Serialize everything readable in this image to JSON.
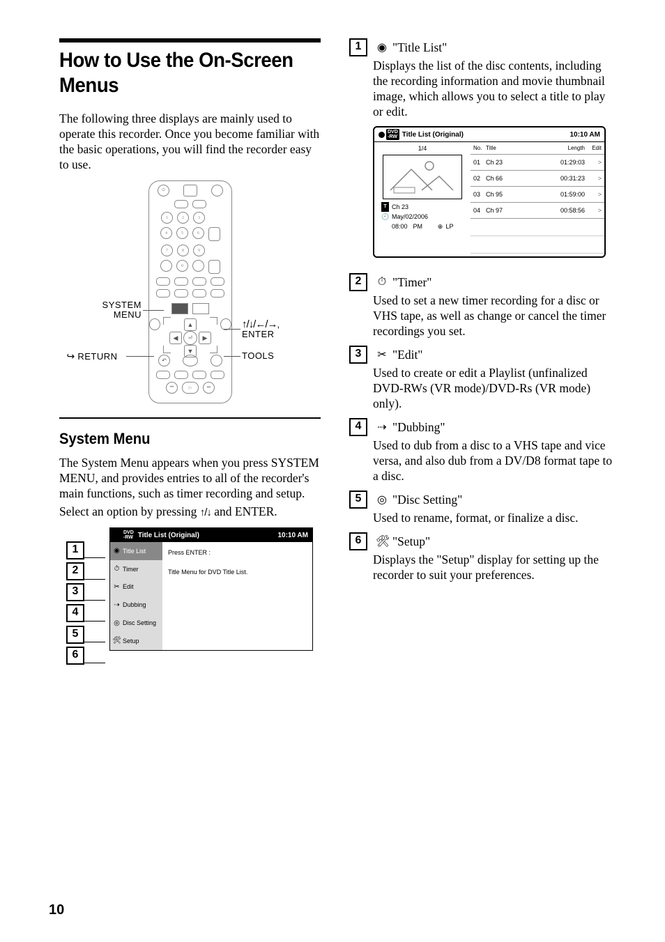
{
  "page_number": "10",
  "heading": "How to Use the On-Screen Menus",
  "intro": "The following three displays are mainly used to operate this recorder. Once you become familiar with the basic operations, you will find the recorder easy to use.",
  "remote_labels": {
    "system_menu": "SYSTEM MENU",
    "return": "RETURN",
    "arrows_enter_line1": "M/m/</,,",
    "arrows_enter_line2": "ENTER",
    "tools": "TOOLS"
  },
  "system_menu_section": {
    "title": "System Menu",
    "para1": "The System Menu appears when you press SYSTEM MENU, and provides entries to all of the recorder's main functions, such as timer recording and setup.",
    "para2_prefix": "Select an option by pressing ",
    "para2_arrows": "M/m",
    "para2_suffix": " and ENTER."
  },
  "system_menu_screen": {
    "header_title": "Title List (Original)",
    "header_time": "10:10 AM",
    "items": [
      {
        "icon": "disc",
        "label": "Title List"
      },
      {
        "icon": "timer",
        "label": "Timer"
      },
      {
        "icon": "edit",
        "label": "Edit"
      },
      {
        "icon": "dubbing",
        "label": "Dubbing"
      },
      {
        "icon": "disc-setting",
        "label": "Disc Setting"
      },
      {
        "icon": "setup",
        "label": "Setup"
      }
    ],
    "main_line1": "Press ENTER :",
    "main_line2": "Title Menu for DVD Title List."
  },
  "callouts": [
    "1",
    "2",
    "3",
    "4",
    "5",
    "6"
  ],
  "title_list": {
    "header_title": "Title List (Original)",
    "header_time": "10:10 AM",
    "page": "1/4",
    "columns": {
      "no": "No.",
      "title": "Title",
      "length": "Length",
      "edit": "Edit"
    },
    "rows": [
      {
        "no": "01",
        "title": "Ch 23",
        "length": "01:29:03",
        "edit": ">"
      },
      {
        "no": "02",
        "title": "Ch 66",
        "length": "00:31:23",
        "edit": ">"
      },
      {
        "no": "03",
        "title": "Ch 95",
        "length": "01:59:00",
        "edit": ">"
      },
      {
        "no": "04",
        "title": "Ch 97",
        "length": "00:58:56",
        "edit": ">"
      }
    ],
    "meta": {
      "ch": "Ch 23",
      "date": "May/02/2006",
      "time": "08:00",
      "ampm": "PM",
      "mode": "LP"
    }
  },
  "items": [
    {
      "num": "1",
      "icon": "disc",
      "label": "\"Title List\"",
      "desc": "Displays the list of the disc contents, including the recording information and movie thumbnail image, which allows you to select a title to play or edit."
    },
    {
      "num": "2",
      "icon": "timer",
      "label": "\"Timer\"",
      "desc": "Used to set a new timer recording for a disc or VHS tape, as well as change or cancel the timer recordings you set."
    },
    {
      "num": "3",
      "icon": "edit",
      "label": "\"Edit\"",
      "desc": "Used to create or edit a Playlist (unfinalized DVD-RWs (VR mode)/DVD-Rs (VR mode) only)."
    },
    {
      "num": "4",
      "icon": "dubbing",
      "label": "\"Dubbing\"",
      "desc": "Used to dub from a disc to a VHS tape and vice versa, and also dub from a DV/D8 format tape to a disc."
    },
    {
      "num": "5",
      "icon": "disc-setting",
      "label": "\"Disc Setting\"",
      "desc": "Used to rename, format, or finalize a disc."
    },
    {
      "num": "6",
      "icon": "setup",
      "label": "\"Setup\"",
      "desc": "Displays the \"Setup\" display for setting up the recorder to suit your preferences."
    }
  ]
}
